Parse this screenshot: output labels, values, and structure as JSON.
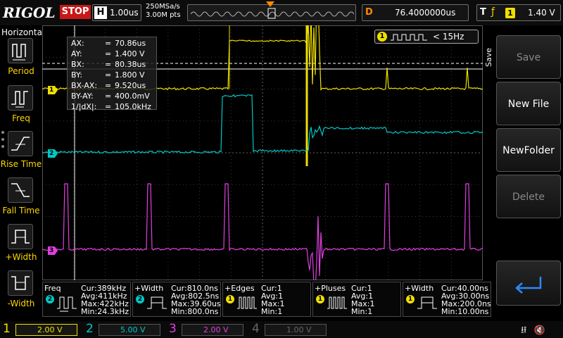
{
  "topbar": {
    "logo": "RIGOL",
    "run_state": "STOP",
    "horizontal_letter": "H",
    "timebase": "1.00us",
    "sample_rate": "250MSa/s",
    "points": "3.00M pts",
    "delay_letter": "D",
    "delay": "76.4000000us",
    "trigger_letter": "T",
    "trigger_source": "1",
    "trigger_level": "1.40 V"
  },
  "left_menu": {
    "title": "Horizontal",
    "items": [
      {
        "label": "Period",
        "icon": "period-icon"
      },
      {
        "label": "Freq",
        "icon": "freq-icon"
      },
      {
        "label": "Rise Time",
        "icon": "rise-time-icon"
      },
      {
        "label": "Fall Time",
        "icon": "fall-time-icon"
      },
      {
        "label": "+Width",
        "icon": "plus-width-icon"
      },
      {
        "label": "-Width",
        "icon": "minus-width-icon"
      }
    ]
  },
  "cursor_readout": {
    "rows": [
      {
        "k": "AX:",
        "v": "70.86us"
      },
      {
        "k": "AY:",
        "v": "1.400 V"
      },
      {
        "k": "BX:",
        "v": "80.38us"
      },
      {
        "k": "BY:",
        "v": "1.800 V"
      },
      {
        "k": "BX-AX:",
        "v": "9.520us"
      },
      {
        "k": "BY-AY:",
        "v": "400.0mV"
      },
      {
        "k": "1/|dX|:",
        "v": "105.0kHz"
      }
    ]
  },
  "freq_counter": {
    "channel": "1",
    "value": "< 15Hz"
  },
  "right_menu": {
    "side_label": "Save",
    "buttons": [
      {
        "label": "Save",
        "enabled": false
      },
      {
        "label": "New File",
        "enabled": true
      },
      {
        "label": "NewFolder",
        "enabled": true
      },
      {
        "label": "Delete",
        "enabled": false
      }
    ],
    "back_icon": "return-arrow-icon"
  },
  "measurements": [
    {
      "name": "Freq",
      "channel": "2",
      "color": "#00c8c8",
      "cur": "Cur:389kHz",
      "avg": "Avg:411kHz",
      "max": "Max:422kHz",
      "min": "Min:24.3kHz"
    },
    {
      "name": "+Width",
      "channel": "2",
      "color": "#00c8c8",
      "cur": "Cur:810.0ns",
      "avg": "Avg:802.5ns",
      "max": "Max:39.60us",
      "min": "Min:800.0ns"
    },
    {
      "name": "+Edges",
      "channel": "1",
      "color": "#f0e000",
      "cur": "Cur:1",
      "avg": "Avg:1",
      "max": "Max:1",
      "min": "Min:1"
    },
    {
      "name": "+Pluses",
      "channel": "1",
      "color": "#f0e000",
      "cur": "Cur:1",
      "avg": "Avg:1",
      "max": "Max:1",
      "min": "Min:1"
    },
    {
      "name": "+Width",
      "channel": "1",
      "color": "#f0e000",
      "cur": "Cur:40.00ns",
      "avg": "Avg:30.00ns",
      "max": "Max:200.0ns",
      "min": "Min:10.00ns"
    }
  ],
  "channels": [
    {
      "num": "1",
      "scale": "2.00 V",
      "color": "#f0e000",
      "active": true
    },
    {
      "num": "2",
      "scale": "5.00 V",
      "color": "#00c8c8",
      "active": true
    },
    {
      "num": "3",
      "scale": "2.00 V",
      "color": "#e040e0",
      "active": true
    },
    {
      "num": "4",
      "scale": "1.00 V",
      "color": "#4060ff",
      "active": false
    }
  ],
  "status_icons": [
    "usb-icon",
    "speaker-mute-icon"
  ]
}
